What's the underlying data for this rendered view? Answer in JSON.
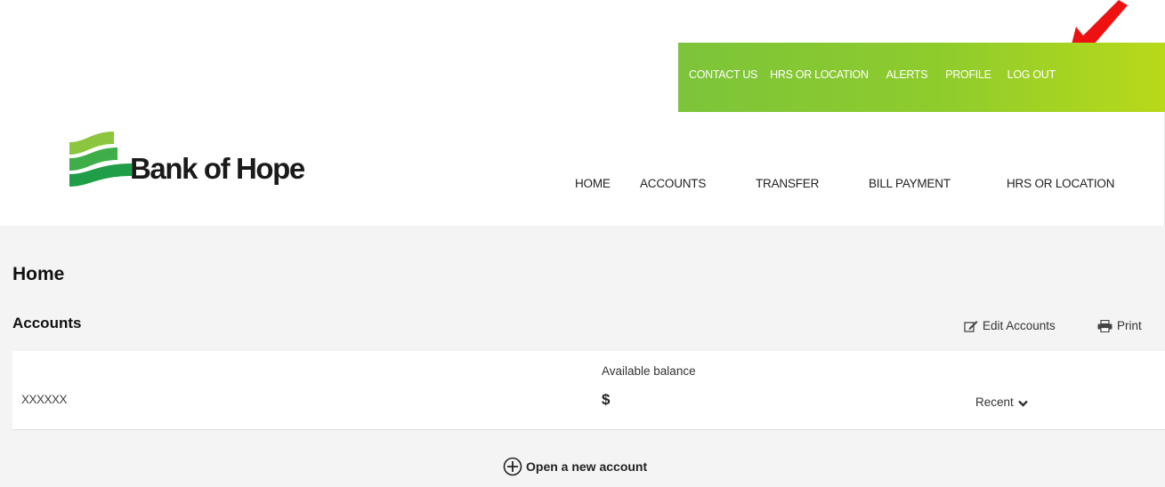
{
  "utility_nav": {
    "items": [
      "CONTACT US",
      "HRS OR LOCATION",
      "ALERTS",
      "PROFILE",
      "LOG OUT"
    ]
  },
  "brand": {
    "name": "Bank of Hope",
    "logo_icon": "bank-of-hope-logo-mark"
  },
  "main_nav": {
    "items": [
      "HOME",
      "ACCOUNTS",
      "TRANSFER",
      "BILL PAYMENT",
      "HRS OR LOCATION"
    ]
  },
  "page": {
    "title": "Home"
  },
  "accounts_section": {
    "title": "Accounts",
    "edit_label": "Edit Accounts",
    "edit_icon": "edit-icon",
    "print_label": "Print",
    "print_icon": "printer-icon"
  },
  "account": {
    "name": "XXXXXX",
    "balance_label": "Available balance",
    "balance_value": "$",
    "recent_label": "Recent",
    "recent_icon": "chevron-down-icon"
  },
  "open_account": {
    "label": "Open a new account",
    "icon": "plus-circle-icon"
  },
  "annotation": {
    "icon": "red-arrow-icon",
    "color": "#ee1111"
  },
  "colors": {
    "utility_bar_start": "#7cc43a",
    "utility_bar_end": "#b8d91a",
    "page_bg": "#f4f4f4",
    "logo_green_dark": "#1f9e47",
    "logo_green_light": "#8cc63f"
  }
}
